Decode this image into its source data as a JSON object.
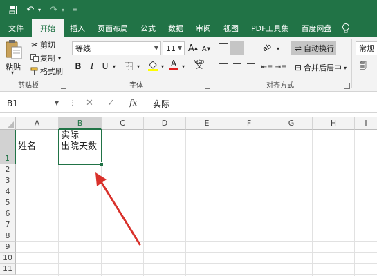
{
  "quick_access": {
    "save_icon": "save-icon",
    "undo_icon": "undo-icon",
    "redo_icon": "redo-icon"
  },
  "tabs": [
    {
      "label": "文件",
      "active": false
    },
    {
      "label": "开始",
      "active": true
    },
    {
      "label": "插入",
      "active": false
    },
    {
      "label": "页面布局",
      "active": false
    },
    {
      "label": "公式",
      "active": false
    },
    {
      "label": "数据",
      "active": false
    },
    {
      "label": "审阅",
      "active": false
    },
    {
      "label": "视图",
      "active": false
    },
    {
      "label": "PDF工具集",
      "active": false
    },
    {
      "label": "百度网盘",
      "active": false
    }
  ],
  "clipboard": {
    "paste_label": "粘贴",
    "cut_label": "剪切",
    "copy_label": "复制",
    "format_painter_label": "格式刷",
    "group_label": "剪贴板"
  },
  "font": {
    "font_name": "等线",
    "font_size": "11",
    "grow_label": "A",
    "shrink_label": "A",
    "bold": "B",
    "italic": "I",
    "underline": "U",
    "color_label": "A",
    "phonetic_label": "wén",
    "group_label": "字体"
  },
  "alignment": {
    "wrap_text_label": "自动换行",
    "merge_center_label": "合并后居中",
    "group_label": "对齐方式"
  },
  "number": {
    "format_value": "常规"
  },
  "formula_bar": {
    "name_box": "B1",
    "cancel": "✕",
    "enter": "✓",
    "fx": "fx",
    "content": "实际"
  },
  "sheet": {
    "columns": [
      "A",
      "B",
      "C",
      "D",
      "E",
      "F",
      "G",
      "H",
      "I"
    ],
    "selected_column": "B",
    "rows": [
      "1",
      "2",
      "3",
      "4",
      "5",
      "6",
      "7",
      "8",
      "9",
      "10",
      "11"
    ],
    "selected_row": "1",
    "cells": {
      "A1": "姓名",
      "B1_line1": "实际",
      "B1_line2": "出院天数"
    }
  },
  "colors": {
    "accent": "#217346",
    "arrow": "#d9312b"
  }
}
